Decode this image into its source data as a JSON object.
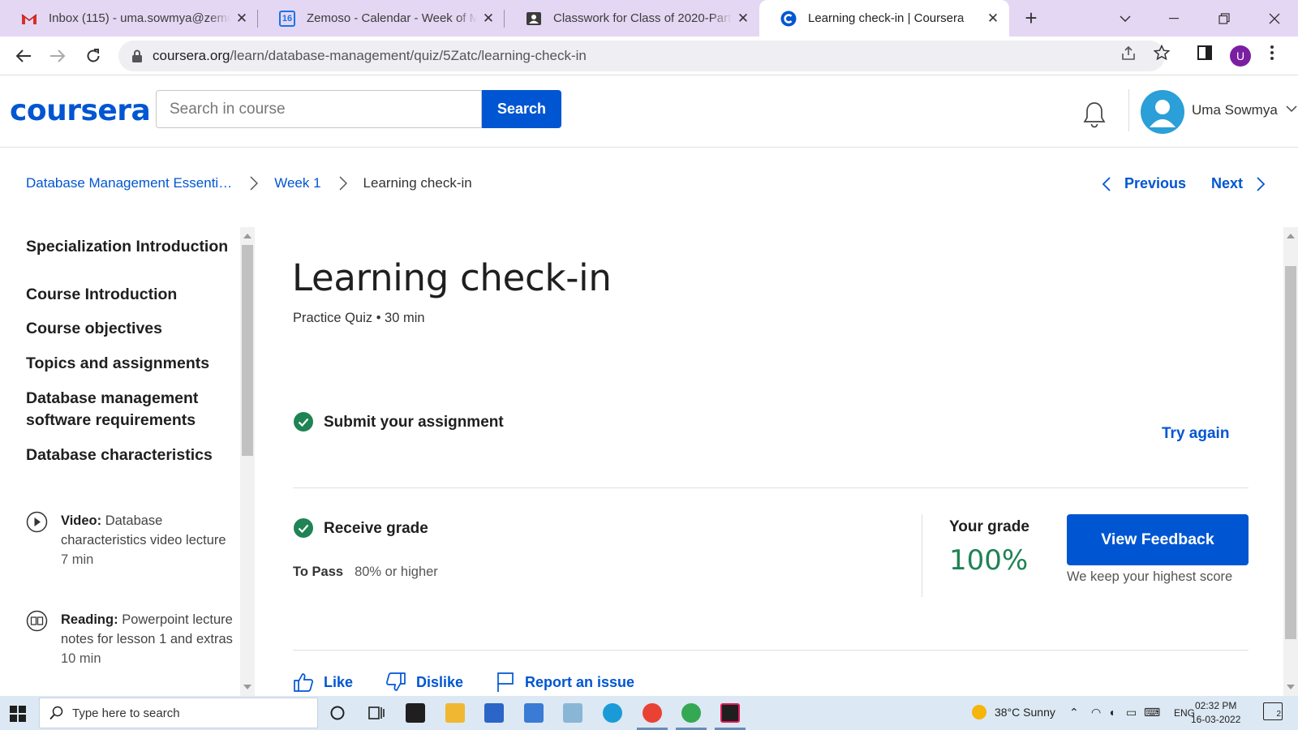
{
  "browser": {
    "tabs": [
      {
        "title": "Inbox (115) - uma.sowmya@zemoso",
        "favicon": "gmail-icon"
      },
      {
        "title": "Zemoso - Calendar - Week of M",
        "favicon": "calendar-icon",
        "badge": "16"
      },
      {
        "title": "Classwork for Class of 2020-Part",
        "favicon": "classroom-icon"
      },
      {
        "title": "Learning check-in | Coursera",
        "favicon": "coursera-icon"
      }
    ],
    "url_domain": "coursera.org",
    "url_path": "/learn/database-management/quiz/5Zatc/learning-check-in",
    "profile_initial": "U"
  },
  "header": {
    "logo": "coursera",
    "search_placeholder": "Search in course",
    "search_button": "Search",
    "user_name": "Uma Sowmya"
  },
  "breadcrumb": {
    "items": [
      "Database Management Essenti…",
      "Week 1"
    ],
    "current": "Learning check-in"
  },
  "pager": {
    "previous": "Previous",
    "next": "Next"
  },
  "sidebar": {
    "sections": [
      "Specialization Introduction",
      "Course Introduction",
      "Course objectives",
      "Topics and assignments",
      "Database management software requirements",
      "Database characteristics"
    ],
    "lessons": [
      {
        "kind": "Video:",
        "title": "Database characteristics video lecture",
        "duration": "7 min",
        "icon": "play-icon"
      },
      {
        "kind": "Reading:",
        "title": "Powerpoint lecture notes for lesson 1 and extras",
        "duration": "10 min",
        "icon": "book-icon"
      }
    ]
  },
  "main": {
    "title": "Learning check-in",
    "meta": "Practice Quiz • 30 min",
    "step1": "Submit your assignment",
    "try_again": "Try again",
    "step2": "Receive grade",
    "to_pass_label": "To Pass",
    "to_pass_value": "80% or higher",
    "grade_label": "Your grade",
    "grade_value": "100%",
    "view_feedback": "View Feedback",
    "keep_note": "We keep your highest score",
    "like": "Like",
    "dislike": "Dislike",
    "report": "Report an issue"
  },
  "taskbar": {
    "search_placeholder": "Type here to search",
    "weather": "38°C  Sunny",
    "lang": "ENG",
    "time": "02:32 PM",
    "date": "16-03-2022",
    "notif_count": "2"
  },
  "colors": {
    "brand": "#0056d2",
    "success": "#1f8354",
    "tabstrip": "#e4d7f3"
  }
}
